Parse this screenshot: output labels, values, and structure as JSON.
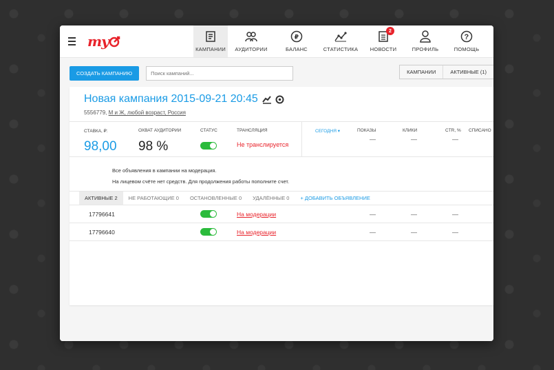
{
  "brand": {
    "logo_text": "my"
  },
  "nav": {
    "items": [
      {
        "label": "КАМПАНИИ",
        "icon": "campaigns-icon",
        "active": true
      },
      {
        "label": "АУДИТОРИИ",
        "icon": "audience-icon"
      },
      {
        "label": "БАЛАНС",
        "icon": "ruble-icon"
      },
      {
        "label": "СТАТИСТИКА",
        "icon": "stats-icon"
      },
      {
        "label": "НОВОСТИ",
        "icon": "news-icon",
        "badge": "2"
      },
      {
        "label": "ПРОФИЛЬ",
        "icon": "profile-icon"
      },
      {
        "label": "ПОМОЩЬ",
        "icon": "help-icon"
      }
    ]
  },
  "toolbar": {
    "create_label": "СОЗДАТЬ КАМПАНИЮ",
    "search_placeholder": "Поиск кампаний...",
    "filter_campaigns": "КАМПАНИИ",
    "filter_active": "АКТИВНЫЕ (1)"
  },
  "campaign": {
    "title": "Новая кампания 2015-09-21 20:45",
    "id": "5556779,",
    "targeting": "М и Ж, любой возраст, Россия"
  },
  "stats": {
    "rate_label": "СТАВКА, ₽:",
    "rate_value": "98,00",
    "reach_label": "ОХВАТ АУДИТОРИИ",
    "reach_value": "98 %",
    "status_label": "СТАТУС",
    "broadcast_label": "ТРАНСЛЯЦИЯ",
    "broadcast_value": "Не транслируется",
    "period": "СЕГОДНЯ ▾",
    "columns": [
      "ПОКАЗЫ",
      "КЛИКИ",
      "CTR, %",
      "СПИСАНО"
    ],
    "dash": "—"
  },
  "notes": {
    "line1": "Все объявления в кампании на модерация.",
    "line2": "На лицевом счёте нет средств. Для продолжения работы пополните счет."
  },
  "ad_tabs": {
    "active": "АКТИВНЫЕ 2",
    "not_working": "НЕ РАБОТАЮЩИЕ 0",
    "stopped": "ОСТАНОВЛЕННЫЕ 0",
    "deleted": "УДАЛЁННЫЕ 0",
    "add": "+ ДОБАВИТЬ ОБЪЯВЛЕНИЕ"
  },
  "ads": [
    {
      "id": "17796641",
      "status": "На модерации"
    },
    {
      "id": "17796640",
      "status": "На модерации"
    }
  ],
  "colors": {
    "accent": "#1a9be5",
    "brand": "#e8232b",
    "toggle_on": "#2bbb3c"
  }
}
